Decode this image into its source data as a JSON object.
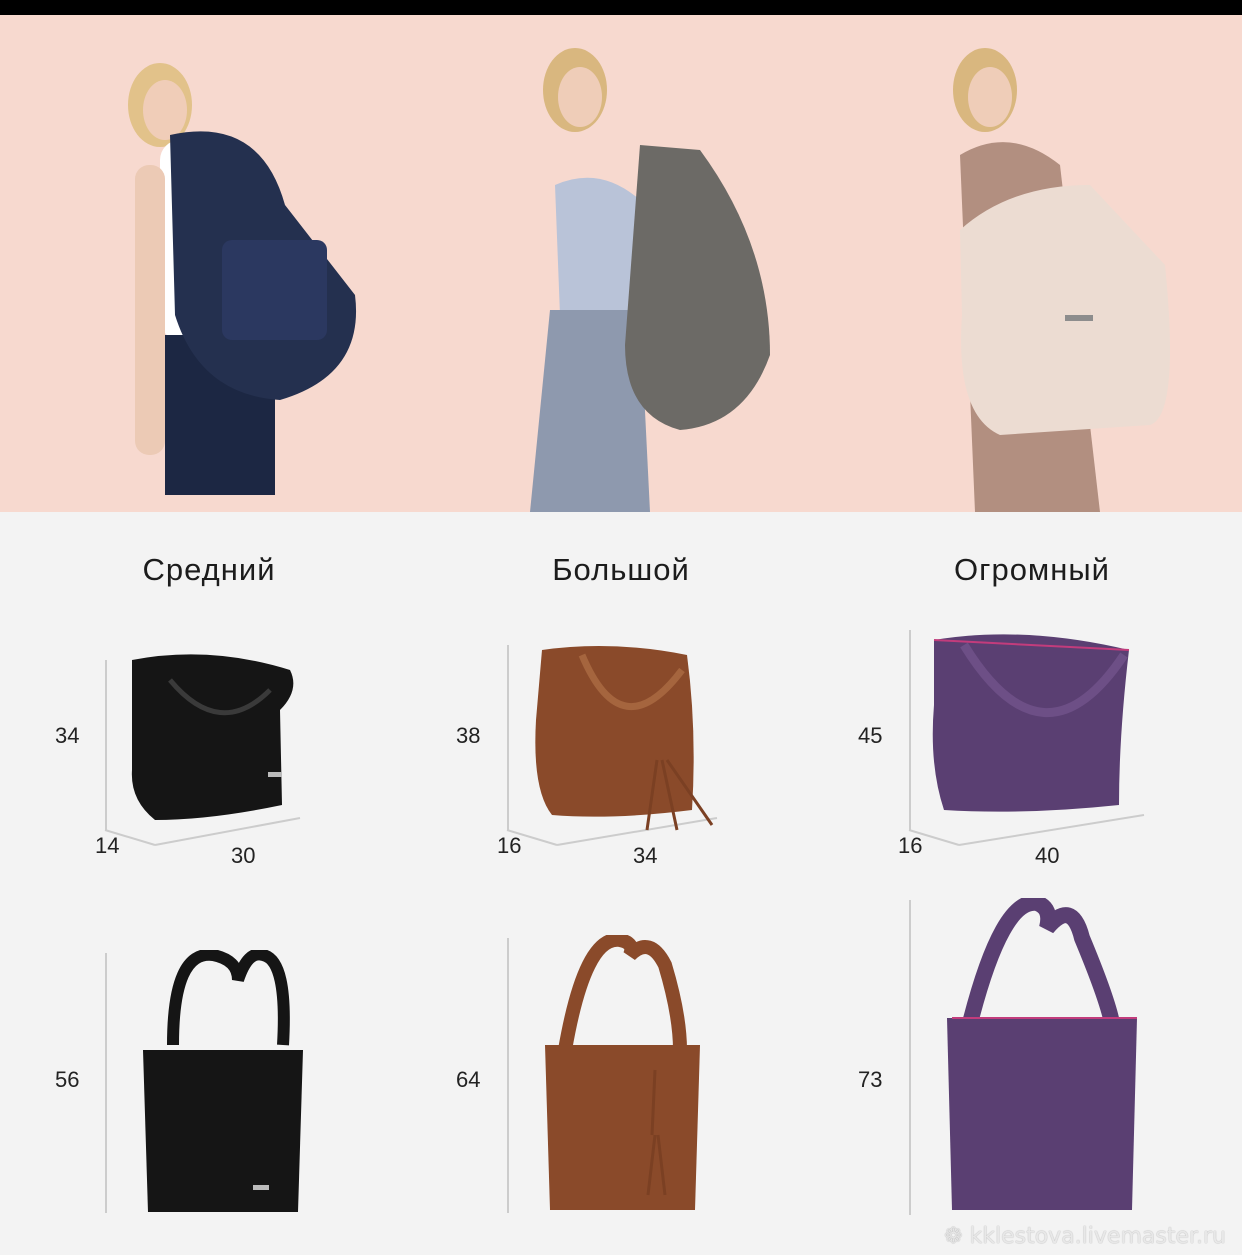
{
  "sizes": [
    {
      "title": "Средний",
      "depth": "14",
      "height": "34",
      "width": "30",
      "tall_height": "56"
    },
    {
      "title": "Большой",
      "depth": "16",
      "height": "38",
      "width": "34",
      "tall_height": "64"
    },
    {
      "title": "Огромный",
      "depth": "16",
      "height": "45",
      "width": "40",
      "tall_height": "73"
    }
  ],
  "colors": {
    "hero_bg": "#f7d9cf",
    "page_bg": "#f3f3f3",
    "navy": "#24304f",
    "grey": "#6c6a66",
    "cream": "#ecdcd2",
    "black": "#151515",
    "brown": "#8a4a2a",
    "purple": "#5a3f72"
  },
  "icons": [
    "flower-icon"
  ],
  "watermark": "kklestova.livemaster.ru"
}
